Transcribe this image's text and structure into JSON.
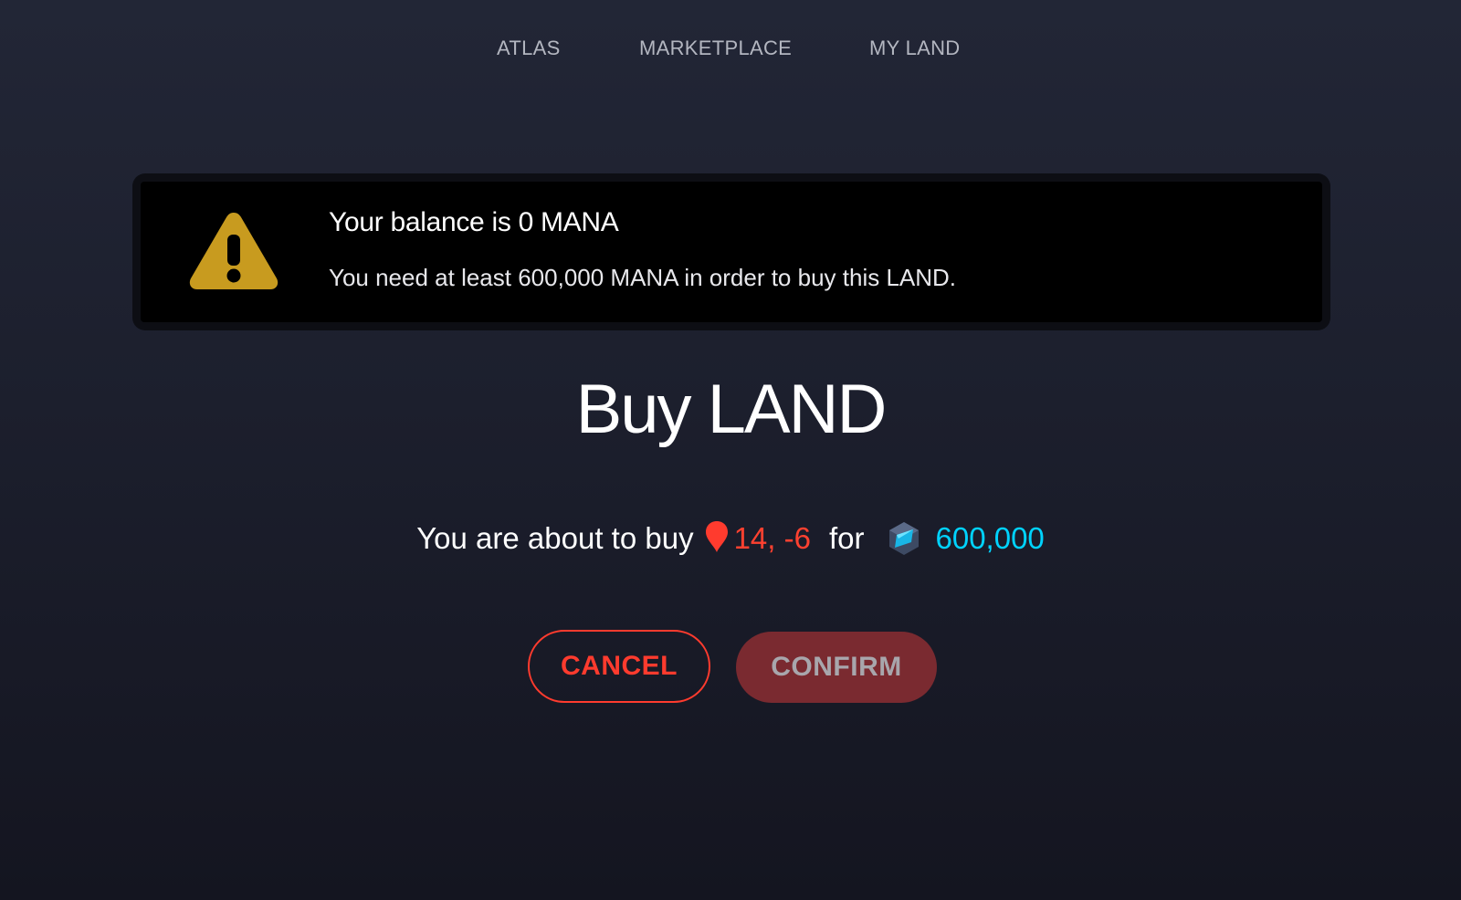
{
  "nav": {
    "items": [
      {
        "label": "ATLAS"
      },
      {
        "label": "MARKETPLACE"
      },
      {
        "label": "MY LAND"
      }
    ]
  },
  "alert": {
    "icon": "warning-icon",
    "title": "Your balance is 0 MANA",
    "message": "You need at least 600,000 MANA in order to buy this LAND."
  },
  "page": {
    "title": "Buy LAND"
  },
  "summary": {
    "prefix": "You are about to buy",
    "coords": "14, -6",
    "connector": "for",
    "price": "600,000",
    "pin_icon": "location-pin-icon",
    "currency_icon": "mana-icon"
  },
  "actions": {
    "cancel_label": "CANCEL",
    "confirm_label": "CONFIRM"
  },
  "colors": {
    "accent_red": "#ff3b2e",
    "mana_blue": "#00d3ff",
    "warning_yellow": "#c89b1f"
  }
}
